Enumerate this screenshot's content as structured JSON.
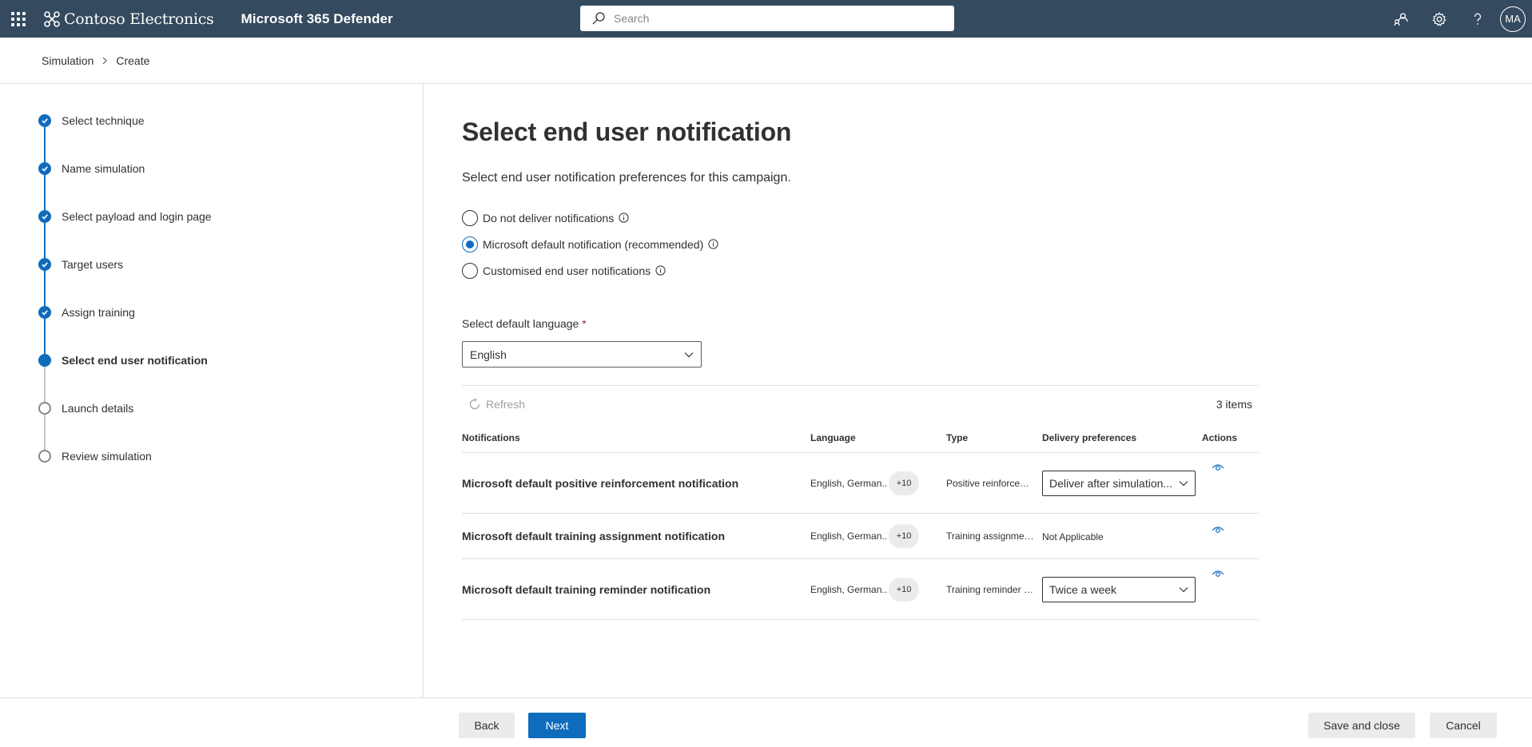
{
  "topbar": {
    "brand": "Contoso Electronics",
    "app_name": "Microsoft 365 Defender",
    "search_placeholder": "Search",
    "avatar_initials": "MA"
  },
  "breadcrumb": {
    "items": [
      "Simulation",
      "Create"
    ]
  },
  "wizard": {
    "steps": [
      {
        "label": "Select technique",
        "state": "done"
      },
      {
        "label": "Name simulation",
        "state": "done"
      },
      {
        "label": "Select payload and login page",
        "state": "done"
      },
      {
        "label": "Target users",
        "state": "done"
      },
      {
        "label": "Assign training",
        "state": "done"
      },
      {
        "label": "Select end user notification",
        "state": "current"
      },
      {
        "label": "Launch details",
        "state": "pending"
      },
      {
        "label": "Review simulation",
        "state": "pending"
      }
    ]
  },
  "main": {
    "title": "Select end user notification",
    "description": "Select end user notification preferences for this campaign.",
    "options": [
      {
        "label": "Do not deliver notifications",
        "checked": false
      },
      {
        "label": "Microsoft default notification (recommended)",
        "checked": true
      },
      {
        "label": "Customised end user notifications",
        "checked": false
      }
    ],
    "language_label": "Select default language",
    "language_required_mark": "*",
    "language_value": "English",
    "refresh_label": "Refresh",
    "item_count": "3 items"
  },
  "table": {
    "columns": [
      "Notifications",
      "Language",
      "Type",
      "Delivery preferences",
      "Actions"
    ],
    "rows": [
      {
        "name": "Microsoft default positive reinforcement notification",
        "language": "English, German..",
        "more": "+10",
        "type": "Positive reinforcem...",
        "delivery": "Deliver after simulation...",
        "has_dropdown": true
      },
      {
        "name": "Microsoft default training assignment notification",
        "language": "English, German..",
        "more": "+10",
        "type": "Training assignmen...",
        "delivery": "Not Applicable",
        "has_dropdown": false
      },
      {
        "name": "Microsoft default training reminder notification",
        "language": "English, German..",
        "more": "+10",
        "type": "Training reminder n...",
        "delivery": "Twice a week",
        "has_dropdown": true
      }
    ]
  },
  "footer": {
    "back": "Back",
    "next": "Next",
    "save_close": "Save and close",
    "cancel": "Cancel"
  },
  "colors": {
    "topbar": "#344a5e",
    "accent": "#0f6cbd"
  }
}
